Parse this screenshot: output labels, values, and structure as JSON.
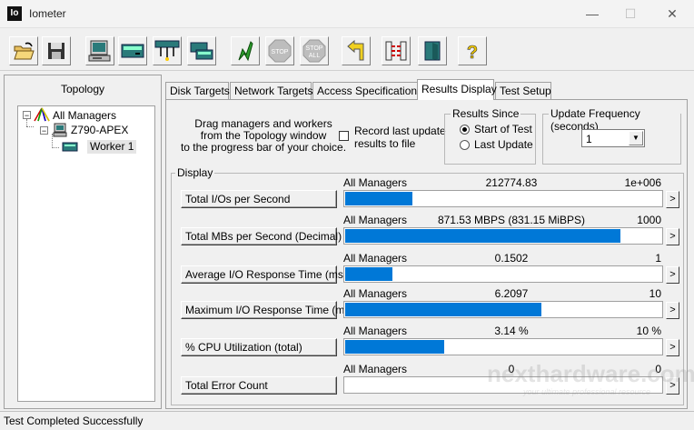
{
  "window": {
    "app_icon_text": "Io",
    "title": "Iometer",
    "minimize": "—",
    "maximize": "☐",
    "close": "✕"
  },
  "toolbar": {
    "buttons": [
      {
        "icon": "open-folder-icon"
      },
      {
        "icon": "save-disk-icon"
      },
      {
        "icon": "new-manager-icon"
      },
      {
        "icon": "new-disk-worker-icon"
      },
      {
        "icon": "new-network-worker-icon"
      },
      {
        "icon": "duplicate-worker-icon"
      },
      {
        "icon": "start-tests-icon",
        "color": "#2e9e2e"
      },
      {
        "icon": "stop-icon",
        "label": "STOP"
      },
      {
        "icon": "stop-all-icon",
        "label": "STOP ALL"
      },
      {
        "icon": "reset-workers-icon"
      },
      {
        "icon": "disconnect-manager-icon"
      },
      {
        "icon": "exit-icon"
      },
      {
        "icon": "help-icon",
        "label": "?"
      }
    ]
  },
  "topology": {
    "title": "Topology",
    "tree": [
      {
        "label": "All Managers",
        "icon": "all-managers-icon",
        "expander": "−"
      },
      {
        "label": "Z790-APEX",
        "icon": "manager-computer-icon",
        "expander": "−"
      },
      {
        "label": "Worker 1",
        "icon": "disk-worker-icon"
      }
    ]
  },
  "tabs": [
    {
      "label": "Disk Targets"
    },
    {
      "label": "Network Targets"
    },
    {
      "label": "Access Specifications"
    },
    {
      "label": "Results Display",
      "active": true
    },
    {
      "label": "Test Setup"
    }
  ],
  "results": {
    "drag_instructions_line1": "Drag managers and workers",
    "drag_instructions_line2": "from the Topology window",
    "drag_instructions_line3": "to the progress bar of your choice.",
    "record_label_line1": "Record last update",
    "record_label_line2": "results to file",
    "record_checked": false,
    "results_since_title": "Results Since",
    "results_since_options": [
      {
        "label": "Start of Test",
        "selected": true
      },
      {
        "label": "Last Update",
        "selected": false
      }
    ],
    "update_frequency_title": "Update Frequency (seconds)",
    "update_frequency_value": "1",
    "display_title": "Display",
    "metrics": [
      {
        "button": "Total I/Os per Second",
        "target": "All Managers",
        "value": "212774.83",
        "max": "1e+006",
        "fill": 0.213
      },
      {
        "button": "Total MBs per Second (Decimal)",
        "target": "All Managers",
        "value": "871.53 MBPS (831.15 MiBPS)",
        "max": "1000",
        "fill": 0.872
      },
      {
        "button": "Average I/O Response Time (ms)",
        "target": "All Managers",
        "value": "0.1502",
        "max": "1",
        "fill": 0.15
      },
      {
        "button": "Maximum I/O Response Time (ms)",
        "target": "All Managers",
        "value": "6.2097",
        "max": "10",
        "fill": 0.621
      },
      {
        "button": "% CPU Utilization (total)",
        "target": "All Managers",
        "value": "3.14 %",
        "max": "10 %",
        "fill": 0.314
      },
      {
        "button": "Total Error Count",
        "target": "All Managers",
        "value": "0",
        "max": "0",
        "fill": 0
      }
    ],
    "arrow_glyph": ">"
  },
  "status": {
    "text": "Test Completed Successfully"
  },
  "watermark": {
    "brand": "nexthardware.com",
    "tagline": "your ultimate professional resource"
  },
  "colors": {
    "bar_fill": "#0078d7",
    "window_bg": "#f0f0f0"
  }
}
